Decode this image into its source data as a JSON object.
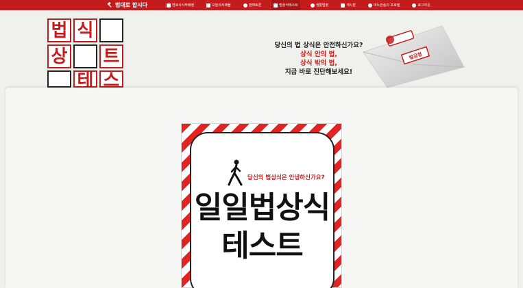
{
  "nav": {
    "brand": "법대로 합시다",
    "items": [
      {
        "label": "변호사사무배정",
        "icon": "checkbox-icon"
      },
      {
        "label": "오늘의사례들",
        "icon": "checkbox-icon"
      },
      {
        "label": "판례토론",
        "icon": "people-icon"
      },
      {
        "label": "법상식테스트",
        "icon": "book-icon"
      },
      {
        "label": "생활법령",
        "icon": "circle-icon"
      },
      {
        "label": "게시판",
        "icon": "checkbox-icon"
      },
      {
        "label": "미노란송의 프로필",
        "icon": "user-icon"
      },
      {
        "label": "로그아웃",
        "icon": "user-icon"
      }
    ]
  },
  "hero": {
    "grid_letters": [
      "법",
      "식",
      "",
      "상",
      "",
      "트",
      "",
      "테",
      "스"
    ],
    "line1": "당신의 법 상식은 안전하신가요?",
    "line2": "상식 안의 법,",
    "line3": "상식 밖의 법,",
    "line4": "지금 바로 진단해보세요!",
    "stamp_label": "벌금형"
  },
  "card": {
    "subtitle": "당신의 법상식은 안녕하신가요?",
    "title_line1": "일일법상식",
    "title_line2": "테스트"
  },
  "colors": {
    "brand_red": "#c41c1c",
    "background": "#f0f0ec"
  }
}
